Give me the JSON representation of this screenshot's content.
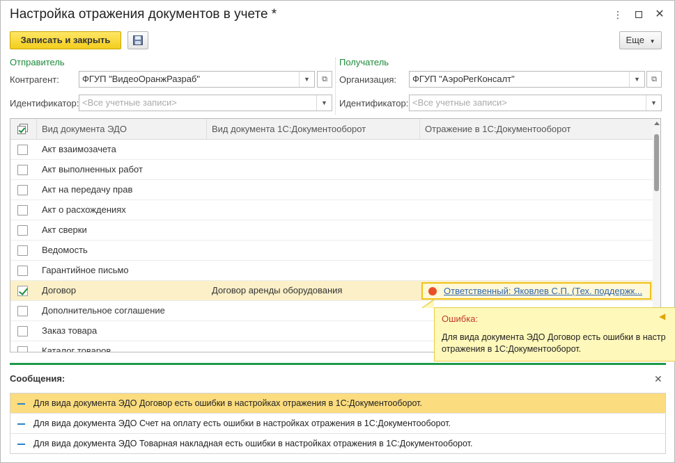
{
  "window": {
    "title": "Настройка отражения документов в учете *"
  },
  "toolbar": {
    "save_close": "Записать и закрыть",
    "more": "Еще"
  },
  "sender": {
    "group_title": "Отправитель",
    "counterparty_label": "Контрагент:",
    "counterparty_value": "ФГУП \"ВидеоОранжРазраб\"",
    "id_label": "Идентификатор:",
    "id_placeholder": "<Все учетные записи>"
  },
  "receiver": {
    "group_title": "Получатель",
    "org_label": "Организация:",
    "org_value": "ФГУП \"АэроРегКонсалт\"",
    "id_label": "Идентификатор:",
    "id_placeholder": "<Все учетные записи>"
  },
  "table": {
    "columns": [
      "Вид документа ЭДО",
      "Вид документа 1С:Документооборот",
      "Отражение в 1С:Документооборот"
    ],
    "rows": [
      {
        "name": "Акт взаимозачета",
        "doc_type": "",
        "reflection": "",
        "checked": false
      },
      {
        "name": "Акт выполненных работ",
        "doc_type": "",
        "reflection": "",
        "checked": false
      },
      {
        "name": "Акт на передачу прав",
        "doc_type": "",
        "reflection": "",
        "checked": false
      },
      {
        "name": "Акт о расхождениях",
        "doc_type": "",
        "reflection": "",
        "checked": false
      },
      {
        "name": "Акт сверки",
        "doc_type": "",
        "reflection": "",
        "checked": false
      },
      {
        "name": "Ведомость",
        "doc_type": "",
        "reflection": "",
        "checked": false
      },
      {
        "name": "Гарантийное письмо",
        "doc_type": "",
        "reflection": "",
        "checked": false
      },
      {
        "name": "Договор",
        "doc_type": "Договор аренды оборудования",
        "reflection": "Ответственный: Яковлев С.П. (Тех. поддержк...",
        "checked": true
      },
      {
        "name": "Дополнительное соглашение",
        "doc_type": "",
        "reflection": "",
        "checked": false
      },
      {
        "name": "Заказ товара",
        "doc_type": "",
        "reflection": "",
        "checked": false
      },
      {
        "name": "Каталог товаров",
        "doc_type": "",
        "reflection": "",
        "checked": false
      }
    ]
  },
  "tooltip": {
    "title": "Ошибка:",
    "text_line1": "Для вида документа ЭДО Договор есть ошибки в настр",
    "text_line2": "отражения в 1С:Документооборот."
  },
  "messages": {
    "title": "Сообщения:",
    "items": [
      "Для вида документа ЭДО Договор есть ошибки в настройках отражения в 1С:Документооборот.",
      "Для вида документа ЭДО Счет на оплату есть ошибки в настройках отражения в 1С:Документооборот.",
      "Для вида документа ЭДО Товарная накладная есть ошибки в настройках отражения в 1С:Документооборот."
    ]
  },
  "colors": {
    "accent_green": "#1c8a39",
    "primary_button": "#f2cd1c",
    "error_dot": "#e8502a",
    "selected_message": "#fbdc7f"
  }
}
